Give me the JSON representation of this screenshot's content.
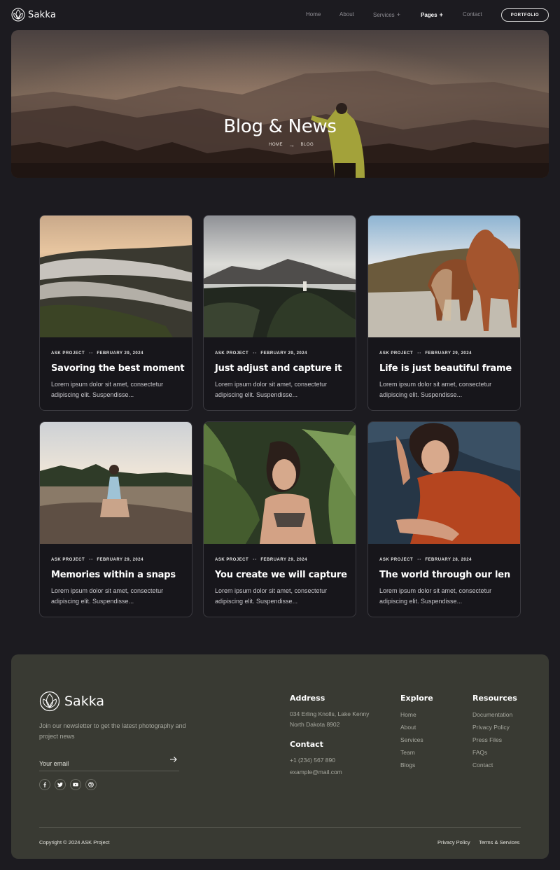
{
  "brand": {
    "name": "Sakka",
    "logo_icon": "leaf-logo-icon"
  },
  "nav": {
    "items": [
      {
        "label": "Home"
      },
      {
        "label": "About"
      },
      {
        "label": "Services",
        "expand": "+"
      },
      {
        "label": "Pages",
        "expand": "+"
      },
      {
        "label": "Contact"
      }
    ],
    "active": "Pages",
    "cta": "PORTFOLIO"
  },
  "hero": {
    "title": "Blog & News",
    "breadcrumb": {
      "home": "HOME",
      "separator": "→",
      "current": "BLOG"
    }
  },
  "posts": [
    {
      "category": "ASK PROJECT",
      "separator": "••",
      "date": "FEBRUARY 29, 2024",
      "title": "Savoring the best moment",
      "excerpt": "Lorem ipsum dolor sit amet, consectetur adipiscing elit. Suspendisse..."
    },
    {
      "category": "ASK PROJECT",
      "separator": "••",
      "date": "FEBRUARY 29, 2024",
      "title": "Just adjust and capture it",
      "excerpt": "Lorem ipsum dolor sit amet, consectetur adipiscing elit. Suspendisse..."
    },
    {
      "category": "ASK PROJECT",
      "separator": "••",
      "date": "FEBRUARY 29, 2024",
      "title": "Life is just beautiful frame",
      "excerpt": "Lorem ipsum dolor sit amet, consectetur adipiscing elit. Suspendisse..."
    },
    {
      "category": "ASK PROJECT",
      "separator": "••",
      "date": "FEBRUARY 29, 2024",
      "title": "Memories within a snaps",
      "excerpt": "Lorem ipsum dolor sit amet, consectetur adipiscing elit. Suspendisse..."
    },
    {
      "category": "ASK PROJECT",
      "separator": "••",
      "date": "FEBRUARY 29, 2024",
      "title": "You create we will capture",
      "excerpt": "Lorem ipsum dolor sit amet, consectetur adipiscing elit. Suspendisse..."
    },
    {
      "category": "ASK PROJECT",
      "separator": "••",
      "date": "FEBRUARY 28, 2024",
      "title": "The world through our len",
      "excerpt": "Lorem ipsum dolor sit amet, consectetur adipiscing elit. Suspendisse..."
    }
  ],
  "footer": {
    "brand": "Sakka",
    "newsletter_text": "Join our newsletter to get the latest photography and project news",
    "email_placeholder": "Your email",
    "send_icon": "arrow-right-icon",
    "socials": [
      "facebook-icon",
      "twitter-icon",
      "youtube-icon",
      "dribbble-icon"
    ],
    "address": {
      "title": "Address",
      "line1": "034 Erling Knolls, Lake Kenny",
      "line2": "North Dakota 8902"
    },
    "contact": {
      "title": "Contact",
      "phone": "+1 (234) 567 890",
      "email": "example@mail.com"
    },
    "explore": {
      "title": "Explore",
      "links": [
        "Home",
        "About",
        "Services",
        "Team",
        "Blogs"
      ]
    },
    "resources": {
      "title": "Resources",
      "links": [
        "Documentation",
        "Privacy Policy",
        "Press Files",
        "FAQs",
        "Contact"
      ]
    },
    "copyright": "Copyright © 2024 ASK Project",
    "legal": [
      "Privacy Policy",
      "Terms & Services"
    ]
  },
  "colors": {
    "page_bg": "#1c1b20",
    "card_bg": "#17161b",
    "footer_bg": "#393a33",
    "muted_text": "#a7a89f"
  }
}
